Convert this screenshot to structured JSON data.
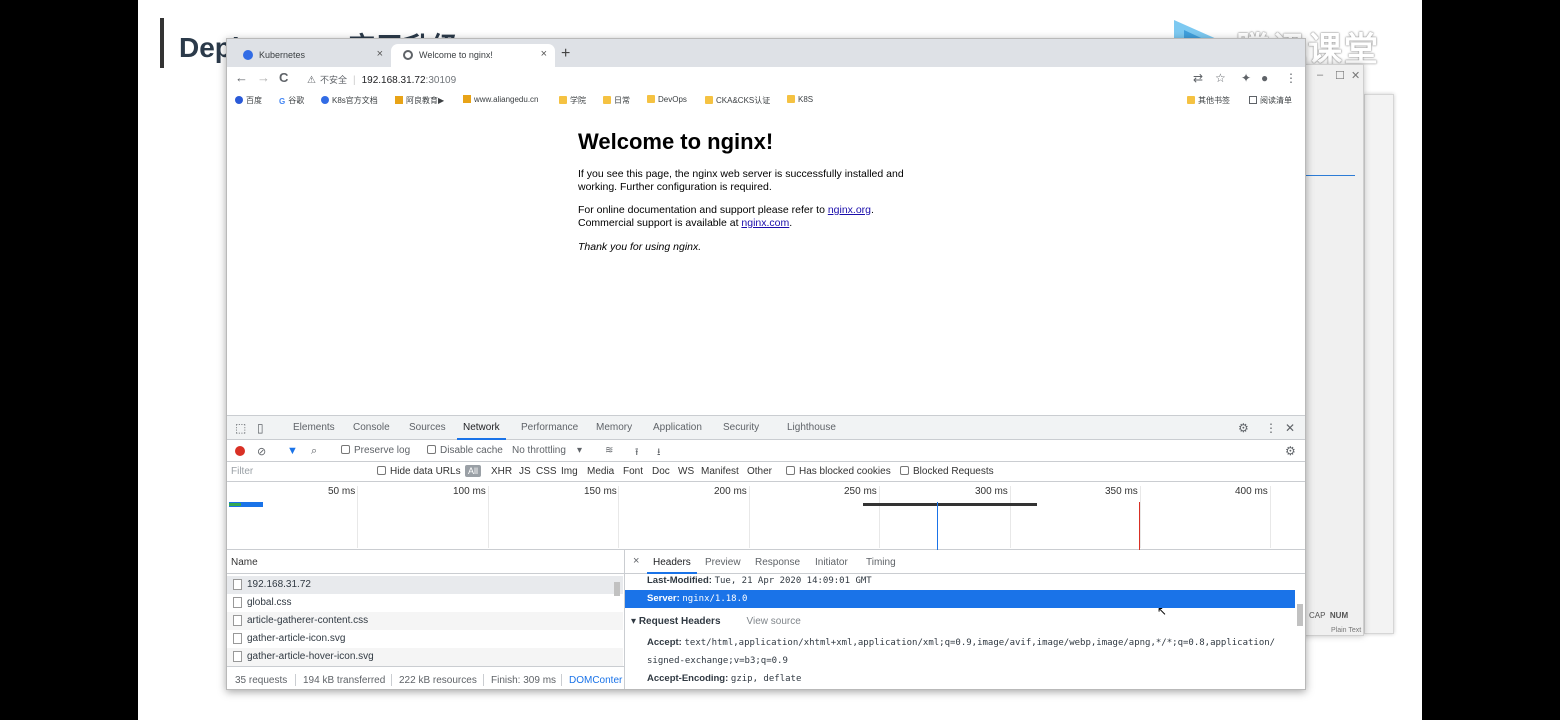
{
  "slide": {
    "title": "Deployment 应用升级"
  },
  "watermark": {
    "text": "腾讯课堂"
  },
  "browser": {
    "tabs": [
      {
        "label": "Kubernetes",
        "icon": "kubernetes-icon",
        "close": "×"
      },
      {
        "label": "Welcome to nginx!",
        "icon": "globe-icon",
        "close": "×"
      }
    ],
    "new_tab": "+",
    "nav": {
      "back": "←",
      "forward": "→",
      "reload": "C"
    },
    "address": {
      "warning": "不安全",
      "host": "192.168.31.72",
      "port": ":30109"
    },
    "bookmarks": [
      {
        "label": "百度",
        "type": "site"
      },
      {
        "label": "谷歌",
        "type": "site"
      },
      {
        "label": "K8s官方文档",
        "type": "site"
      },
      {
        "label": "阿良教育▶",
        "type": "site"
      },
      {
        "label": "www.aliangedu.cn",
        "type": "site"
      },
      {
        "label": "学院",
        "type": "folder"
      },
      {
        "label": "日常",
        "type": "folder"
      },
      {
        "label": "DevOps",
        "type": "folder"
      },
      {
        "label": "CKA&CKS认证",
        "type": "folder"
      },
      {
        "label": "K8S",
        "type": "folder"
      }
    ],
    "other_bookmarks": "其他书签",
    "reading_list": "阅读清单"
  },
  "page": {
    "title": "Welcome to nginx!",
    "p1": "If you see this page, the nginx web server is successfully installed and working. Further configuration is required.",
    "p2_a": "For online documentation and support please refer to ",
    "p2_link1": "nginx.org",
    "p2_b": ".",
    "p2_c": "Commercial support is available at ",
    "p2_link2": "nginx.com",
    "p2_d": ".",
    "p3": "Thank you for using nginx."
  },
  "devtools": {
    "tabs": [
      "Elements",
      "Console",
      "Sources",
      "Network",
      "Performance",
      "Memory",
      "Application",
      "Security",
      "Lighthouse"
    ],
    "active_tab": "Network",
    "toolbar": {
      "preserve_log": "Preserve log",
      "disable_cache": "Disable cache",
      "throttling": "No throttling"
    },
    "filter": {
      "placeholder": "Filter",
      "hide_data_urls": "Hide data URLs",
      "types": [
        "All",
        "XHR",
        "JS",
        "CSS",
        "Img",
        "Media",
        "Font",
        "Doc",
        "WS",
        "Manifest",
        "Other"
      ],
      "blocked_cookies": "Has blocked cookies",
      "blocked_requests": "Blocked Requests"
    },
    "timeline_ticks": [
      "50 ms",
      "100 ms",
      "150 ms",
      "200 ms",
      "250 ms",
      "300 ms",
      "350 ms",
      "400 ms"
    ],
    "name_header": "Name",
    "requests": [
      "192.168.31.72",
      "global.css",
      "article-gatherer-content.css",
      "gather-article-icon.svg",
      "gather-article-hover-icon.svg"
    ],
    "status": {
      "requests": "35 requests",
      "transferred": "194 kB transferred",
      "resources": "222 kB resources",
      "finish": "Finish: 309 ms",
      "dom": "DOMConter"
    },
    "detail_tabs": [
      "Headers",
      "Preview",
      "Response",
      "Initiator",
      "Timing"
    ],
    "detail_close": "×",
    "headers": {
      "last_modified_k": "Last-Modified:",
      "last_modified_v": "Tue, 21 Apr 2020 14:09:01 GMT",
      "server_k": "Server:",
      "server_v": "nginx/1.18.0",
      "request_headers": "Request Headers",
      "view_source": "View source",
      "accept_k": "Accept:",
      "accept_v": "text/html,application/xhtml+xml,application/xml;q=0.9,image/avif,image/webp,image/apng,*/*;q=0.8,application/",
      "accept_v2": "signed-exchange;v=b3;q=0.9",
      "accept_enc_k": "Accept-Encoding:",
      "accept_enc_v": "gzip, deflate"
    }
  },
  "bg_window": {
    "cap": "CAP",
    "num": "NUM",
    "plain_text": "Plain Text"
  },
  "colors": {
    "accent": "#1a73e8",
    "record": "#d93025",
    "folder": "#f5c242"
  }
}
